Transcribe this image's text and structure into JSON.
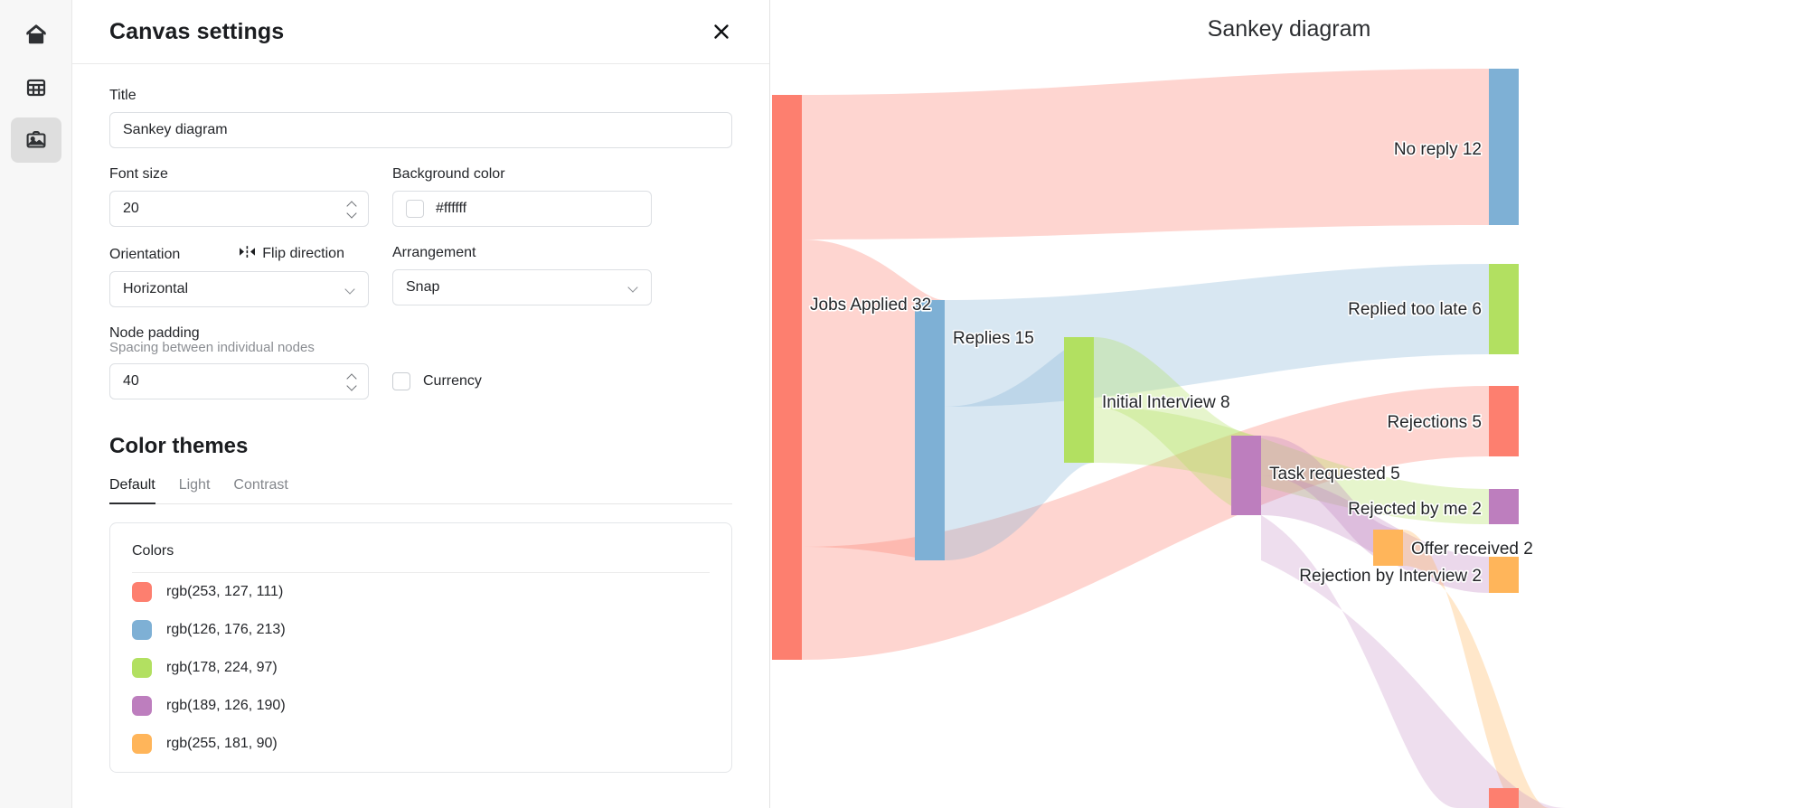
{
  "sidebar": {
    "items": [
      {
        "name": "home-icon",
        "label": "Home"
      },
      {
        "name": "table-icon",
        "label": "Data"
      },
      {
        "name": "canvas-icon",
        "label": "Canvas"
      }
    ]
  },
  "panel": {
    "title": "Canvas settings",
    "close_label": "×",
    "title_field": {
      "label": "Title",
      "value": "Sankey diagram"
    },
    "font_size": {
      "label": "Font size",
      "value": "20"
    },
    "background_color": {
      "label": "Background color",
      "value": "#ffffff",
      "swatch": "#ffffff"
    },
    "orientation": {
      "label": "Orientation",
      "value": "Horizontal"
    },
    "flip_direction": {
      "label": "Flip direction"
    },
    "arrangement": {
      "label": "Arrangement",
      "value": "Snap"
    },
    "node_padding": {
      "label": "Node padding",
      "sublabel": "Spacing between individual nodes",
      "value": "40"
    },
    "currency": {
      "label": "Currency",
      "checked": false
    },
    "color_themes": {
      "heading": "Color themes",
      "tabs": [
        {
          "label": "Default",
          "active": true
        },
        {
          "label": "Light",
          "active": false
        },
        {
          "label": "Contrast",
          "active": false
        }
      ],
      "card_title": "Colors",
      "colors": [
        {
          "label": "rgb(253, 127, 111)",
          "hex": "#fd7f6f"
        },
        {
          "label": "rgb(126, 176, 213)",
          "hex": "#7eb0d5"
        },
        {
          "label": "rgb(178, 224, 97)",
          "hex": "#b2e061"
        },
        {
          "label": "rgb(189, 126, 190)",
          "hex": "#bd7ebe"
        },
        {
          "label": "rgb(255, 181, 90)",
          "hex": "#ffb55a"
        }
      ]
    }
  },
  "canvas": {
    "title": "Sankey diagram"
  },
  "chart_data": {
    "type": "sankey",
    "title": "Sankey diagram",
    "orientation": "Horizontal",
    "arrangement": "Snap",
    "node_padding": 40,
    "font_size": 20,
    "background": "#ffffff",
    "palette": [
      "rgb(253, 127, 111)",
      "rgb(126, 176, 213)",
      "rgb(178, 224, 97)",
      "rgb(189, 126, 190)",
      "rgb(255, 181, 90)"
    ],
    "nodes": [
      {
        "id": "jobs_applied",
        "label": "Jobs Applied 32",
        "value": 32,
        "color": "#fd7f6f",
        "column": 0
      },
      {
        "id": "replies",
        "label": "Replies 15",
        "value": 15,
        "color": "#7eb0d5",
        "column": 1
      },
      {
        "id": "no_reply",
        "label": "No reply 12",
        "value": 12,
        "color": "#7eb0d5",
        "column": 4
      },
      {
        "id": "initial_interview",
        "label": "Initial Interview 8",
        "value": 8,
        "color": "#b2e061",
        "column": 2
      },
      {
        "id": "replied_too_late",
        "label": "Replied too late 6",
        "value": 6,
        "color": "#b2e061",
        "column": 4
      },
      {
        "id": "task_requested",
        "label": "Task requested 5",
        "value": 5,
        "color": "#bd7ebe",
        "column": 3
      },
      {
        "id": "rejections",
        "label": "Rejections 5",
        "value": 5,
        "color": "#fd7f6f",
        "column": 4
      },
      {
        "id": "rejected_by_me",
        "label": "Rejected by me 2",
        "value": 2,
        "color": "#bd7ebe",
        "column": 4
      },
      {
        "id": "offer_received",
        "label": "Offer received 2",
        "value": 2,
        "color": "#ffb55a",
        "column": 3
      },
      {
        "id": "rejection_by_interview",
        "label": "Rejection by Interview 2",
        "value": 2,
        "color": "#ffb55a",
        "column": 4
      }
    ],
    "links": [
      {
        "source": "jobs_applied",
        "target": "no_reply",
        "value": 12
      },
      {
        "source": "jobs_applied",
        "target": "replies",
        "value": 15
      },
      {
        "source": "jobs_applied",
        "target": "rejections",
        "value": 5
      },
      {
        "source": "replies",
        "target": "replied_too_late",
        "value": 6
      },
      {
        "source": "replies",
        "target": "initial_interview",
        "value": 8
      },
      {
        "source": "initial_interview",
        "target": "task_requested",
        "value": 5
      },
      {
        "source": "initial_interview",
        "target": "rejected_by_me",
        "value": 2
      },
      {
        "source": "task_requested",
        "target": "offer_received",
        "value": 2
      },
      {
        "source": "task_requested",
        "target": "rejection_by_interview",
        "value": 2
      }
    ]
  }
}
